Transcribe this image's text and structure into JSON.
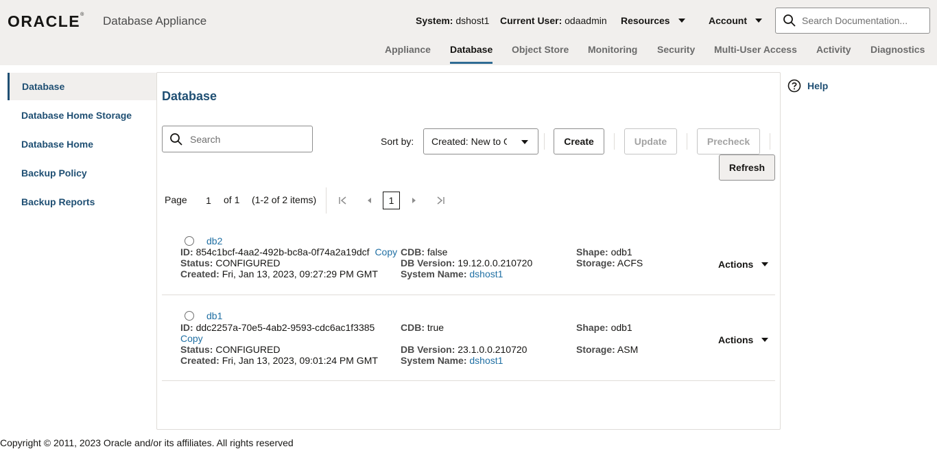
{
  "header": {
    "logo": "ORACLE",
    "app_name": "Database Appliance",
    "system_label": "System:",
    "system_value": "dshost1",
    "user_label": "Current User:",
    "user_value": "odaadmin",
    "resources": "Resources",
    "account": "Account",
    "search_placeholder": "Search Documentation..."
  },
  "nav": {
    "tabs": [
      "Appliance",
      "Database",
      "Object Store",
      "Monitoring",
      "Security",
      "Multi-User Access",
      "Activity",
      "Diagnostics"
    ],
    "active": "Database"
  },
  "sidebar": {
    "items": [
      "Database",
      "Database Home Storage",
      "Database Home",
      "Backup Policy",
      "Backup Reports"
    ],
    "active": "Database"
  },
  "panel": {
    "title": "Database",
    "search_placeholder": "Search",
    "sort_label": "Sort by:",
    "sort_value": "Created: New to Old",
    "buttons": {
      "create": "Create",
      "update": "Update",
      "precheck": "Precheck",
      "refresh": "Refresh"
    }
  },
  "pager": {
    "page_label": "Page",
    "page_value": "1",
    "of_label": "of 1",
    "items_label": "(1-2 of 2 items)",
    "current": "1"
  },
  "labels": {
    "id": "ID:",
    "status": "Status:",
    "created": "Created:",
    "cdb": "CDB:",
    "db_version": "DB Version:",
    "system_name": "System Name:",
    "shape": "Shape:",
    "storage": "Storage:",
    "copy": "Copy",
    "actions": "Actions"
  },
  "databases": [
    {
      "name": "db2",
      "id": "854c1bcf-4aa2-492b-bc8a-0f74a2a19dcf",
      "status": "CONFIGURED",
      "created": "Fri, Jan 13, 2023, 09:27:29 PM GMT",
      "cdb": "false",
      "db_version": "19.12.0.0.210720",
      "system_name": "dshost1",
      "shape": "odb1",
      "storage": "ACFS"
    },
    {
      "name": "db1",
      "id": "ddc2257a-70e5-4ab2-9593-cdc6ac1f3385",
      "status": "CONFIGURED",
      "created": "Fri, Jan 13, 2023, 09:01:24 PM GMT",
      "cdb": "true",
      "db_version": "23.1.0.0.210720",
      "system_name": "dshost1",
      "shape": "odb1",
      "storage": "ASM"
    }
  ],
  "help": "Help",
  "footer": "Copyright © 2011, 2023 Oracle and/or its affiliates. All rights reserved",
  "colors": {
    "accent": "#1f4f73",
    "link": "#1f6fa3",
    "header_bg": "#f1efed"
  }
}
